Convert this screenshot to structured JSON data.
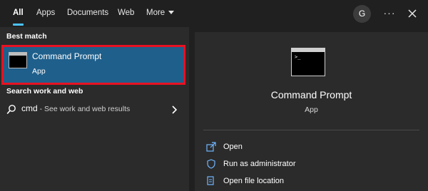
{
  "tabs": [
    {
      "label": "All"
    },
    {
      "label": "Apps"
    },
    {
      "label": "Documents"
    },
    {
      "label": "Web"
    },
    {
      "label": "More"
    }
  ],
  "user": {
    "initial": "G"
  },
  "more_options": {
    "label": "···"
  },
  "left_panel": {
    "best_match_title": "Best match",
    "best_match": {
      "name": "Command Prompt",
      "type": "App",
      "icon": "command-prompt-icon"
    },
    "search_title": "Search work and web",
    "web_result": {
      "query": "cmd",
      "hint": " - See work and web results",
      "icon": "search-icon"
    }
  },
  "detail_panel": {
    "app_name": "Command Prompt",
    "app_type": "App",
    "actions": [
      {
        "label": "Open",
        "icon": "open-icon"
      },
      {
        "label": "Run as administrator",
        "icon": "shield-icon"
      },
      {
        "label": "Open file location",
        "icon": "file-location-icon"
      }
    ]
  },
  "colors": {
    "accent": "#4cc2ff",
    "selection": "#1f5f8b",
    "highlight_border": "#e81123",
    "icon_accent": "#6fb6ff"
  }
}
